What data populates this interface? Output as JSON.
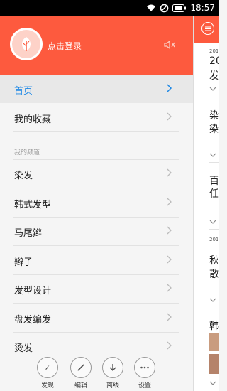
{
  "status_bar": {
    "time": "18:57"
  },
  "drawer": {
    "header": {
      "login_label": "点击登录"
    },
    "home_label": "首页",
    "favorites_label": "我的收藏",
    "channels_section_label": "我的频道",
    "channels": [
      "染发",
      "韩式发型",
      "马尾辫",
      "辫子",
      "发型设计",
      "盘发编发",
      "烫发"
    ],
    "actions": [
      {
        "label": "发现",
        "icon": "compass-icon"
      },
      {
        "label": "编辑",
        "icon": "pencil-icon"
      },
      {
        "label": "离线",
        "icon": "download-icon"
      },
      {
        "label": "设置",
        "icon": "more-dots-icon"
      }
    ]
  },
  "content_peek": {
    "items": [
      {
        "date": "201",
        "line1": "20",
        "line2": "发"
      },
      {
        "line1": "染",
        "line2": "染"
      },
      {
        "line1": "百",
        "line2": "任"
      },
      {
        "date": "201",
        "line1": "秋",
        "line2": "散"
      },
      {
        "line1": "韩"
      }
    ]
  },
  "colors": {
    "accent": "#fd5a3e",
    "active_link": "#1e88e5"
  }
}
